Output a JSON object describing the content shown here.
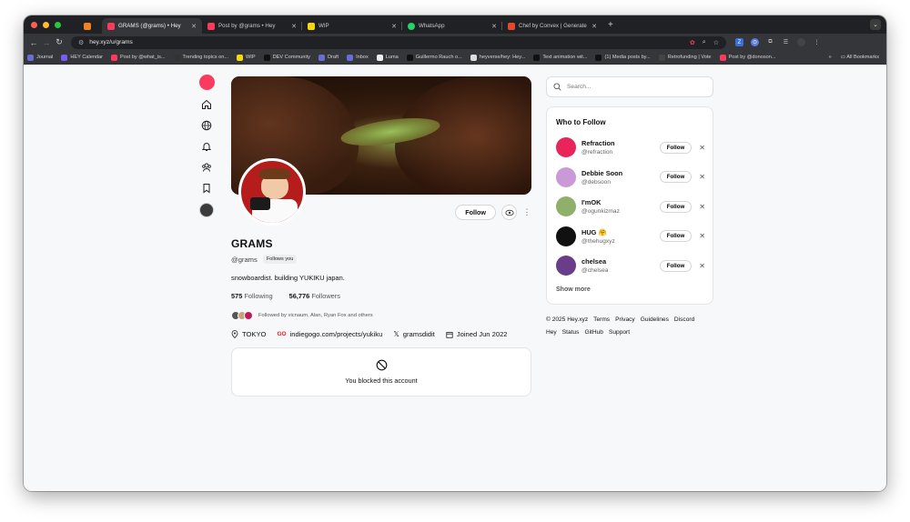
{
  "browser": {
    "tabs": [
      {
        "title": "GRAMS (@grams) • Hey",
        "color": "#fb3a5d",
        "active": true
      },
      {
        "title": "Post by @grams • Hey",
        "color": "#fb3a5d",
        "active": false
      },
      {
        "title": "WIP",
        "color": "#f5d90a",
        "active": false
      },
      {
        "title": "WhatsApp",
        "color": "#25d366",
        "active": false
      },
      {
        "title": "Chef by Convex | Generate re",
        "color": "#e5482a",
        "active": false
      }
    ],
    "url": "hey.xyz/u/grams",
    "bookmarks": [
      {
        "label": "Journal",
        "color": "#6b6bd6"
      },
      {
        "label": "HEY Calendar",
        "color": "#7a5af8"
      },
      {
        "label": "Post by @what_is...",
        "color": "#fb3a5d"
      },
      {
        "label": "Trending topics on...",
        "color": "#333"
      },
      {
        "label": "WIP",
        "color": "#f5d90a"
      },
      {
        "label": "DEV Community",
        "color": "#111"
      },
      {
        "label": "Draft",
        "color": "#6b6bd6"
      },
      {
        "label": "Inbox",
        "color": "#6b6bd6"
      },
      {
        "label": "Luma",
        "color": "#eee"
      },
      {
        "label": "Guillermo Rauch o...",
        "color": "#111"
      },
      {
        "label": "heyverse/hey: Hey...",
        "color": "#ddd"
      },
      {
        "label": "Text animation wit...",
        "color": "#111"
      },
      {
        "label": "(1) Media posts by...",
        "color": "#111"
      },
      {
        "label": "Retrofunding | Vote",
        "color": "#444"
      },
      {
        "label": "Post by @donoson...",
        "color": "#fb3a5d"
      }
    ],
    "all_bookmarks": "All Bookmarks"
  },
  "profile": {
    "name": "GRAMS",
    "handle": "@grams",
    "follows_you": "Follows you",
    "bio": "snowboardist. building YUKIKU japan.",
    "following_count": "575",
    "following_label": "Following",
    "followers_count": "56,776",
    "followers_label": "Followers",
    "followed_by": "Followed by vicnaum, Alan, Ryan Fox and others",
    "location": "TOKYO",
    "website": "indiegogo.com/projects/yukiku",
    "x_handle": "gramsdidit",
    "joined": "Joined Jun 2022",
    "follow_button": "Follow",
    "blocked_message": "You blocked this account"
  },
  "search": {
    "placeholder": "Search..."
  },
  "who_to_follow": {
    "title": "Who to Follow",
    "follow_label": "Follow",
    "show_more": "Show more",
    "users": [
      {
        "name": "Refraction",
        "handle": "@refraction",
        "avatar_color": "#e8245a"
      },
      {
        "name": "Debbie Soon",
        "handle": "@debsoon",
        "avatar_color": "#c99ad6"
      },
      {
        "name": "I'mOK",
        "handle": "@ogunkizmaz",
        "avatar_color": "#8fb06a"
      },
      {
        "name": "HUG 🤗",
        "handle": "@thehugxyz",
        "avatar_color": "#111111"
      },
      {
        "name": "chelsea",
        "handle": "@chelsea",
        "avatar_color": "#6a3d8a"
      }
    ]
  },
  "footer": {
    "copyright": "© 2025 Hey.xyz",
    "links_row1": [
      "Terms",
      "Privacy",
      "Guidelines",
      "Discord"
    ],
    "links_row2": [
      "Hey",
      "Status",
      "GitHub",
      "Support"
    ]
  }
}
